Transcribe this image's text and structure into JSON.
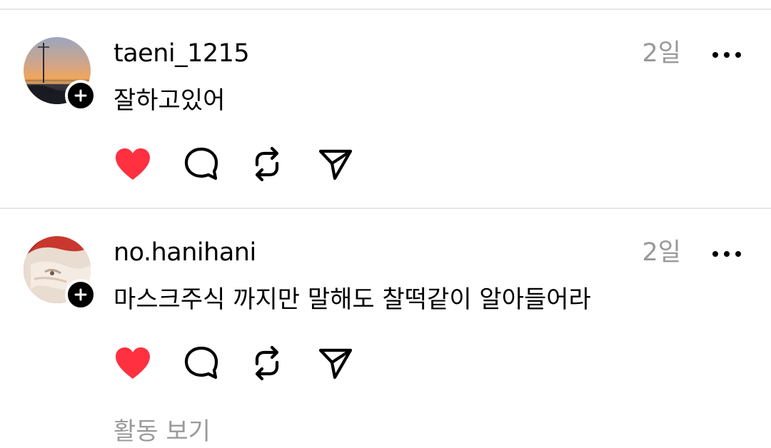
{
  "posts": [
    {
      "username": "taeni_1215",
      "time": "2일",
      "content": "잘하고있어",
      "liked": true,
      "avatar": "sunset-photo"
    },
    {
      "username": "no.hanihani",
      "time": "2일",
      "content": "마스크주식 까지만 말해도 찰떡같이 알아들어라",
      "liked": true,
      "avatar": "painting-photo"
    }
  ],
  "footer": {
    "activity_label": "활동 보기"
  },
  "colors": {
    "like": "#ff3040",
    "secondary_text": "#999999",
    "divider": "#e6e6e6"
  },
  "icons": {
    "like": "heart-icon",
    "comment": "comment-bubble-icon",
    "repost": "repost-icon",
    "share": "send-icon",
    "more": "more-dots-icon",
    "follow": "plus-icon"
  }
}
